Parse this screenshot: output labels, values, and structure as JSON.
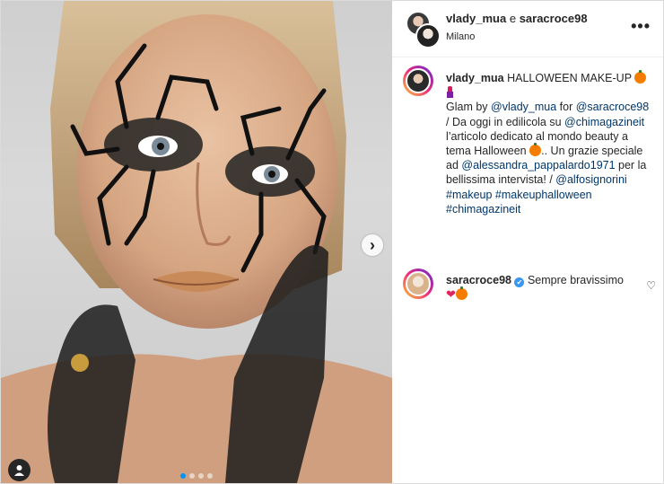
{
  "header": {
    "user1": "vlady_mua",
    "joiner": "e",
    "user2": "saracroce98",
    "location": "Milano",
    "more_label": "•••"
  },
  "caption": {
    "user": "vlady_mua",
    "title": "HALLOWEEN MAKE-UP",
    "line_glam": "Glam by",
    "mention_vlady": "@vlady_mua",
    "for": "for",
    "mention_sara": "@saracroce98",
    "text1": "/ Da oggi in edilicola su",
    "mention_chi": "@chimagazineit",
    "text2": "l’articolo dedicato al mondo beauty a tema Halloween",
    "text3": ".. Un grazie speciale ad",
    "mention_alessandra": "@alessandra_pappalardo1971",
    "text4": "per la bellissima intervista! /",
    "mention_alfo": "@alfosignorini",
    "tag1": "#makeup",
    "tag2": "#makeuphalloween",
    "tag3": "#chimagazineit"
  },
  "comment": {
    "user": "saracroce98",
    "verified_mark": "✔",
    "text": "Sempre bravissimo",
    "heart": "❤",
    "like_icon": "♡"
  },
  "carousel": {
    "next_icon": "›",
    "slides": 4,
    "active_slide": 1
  },
  "icons": {
    "verified": "verified-badge-icon",
    "heart": "heart-icon",
    "pumpkin": "pumpkin-emoji",
    "lipstick": "lipstick-emoji"
  },
  "colors": {
    "link": "#00376b",
    "verified": "#3897f0",
    "active_dot": "#0095f6"
  }
}
